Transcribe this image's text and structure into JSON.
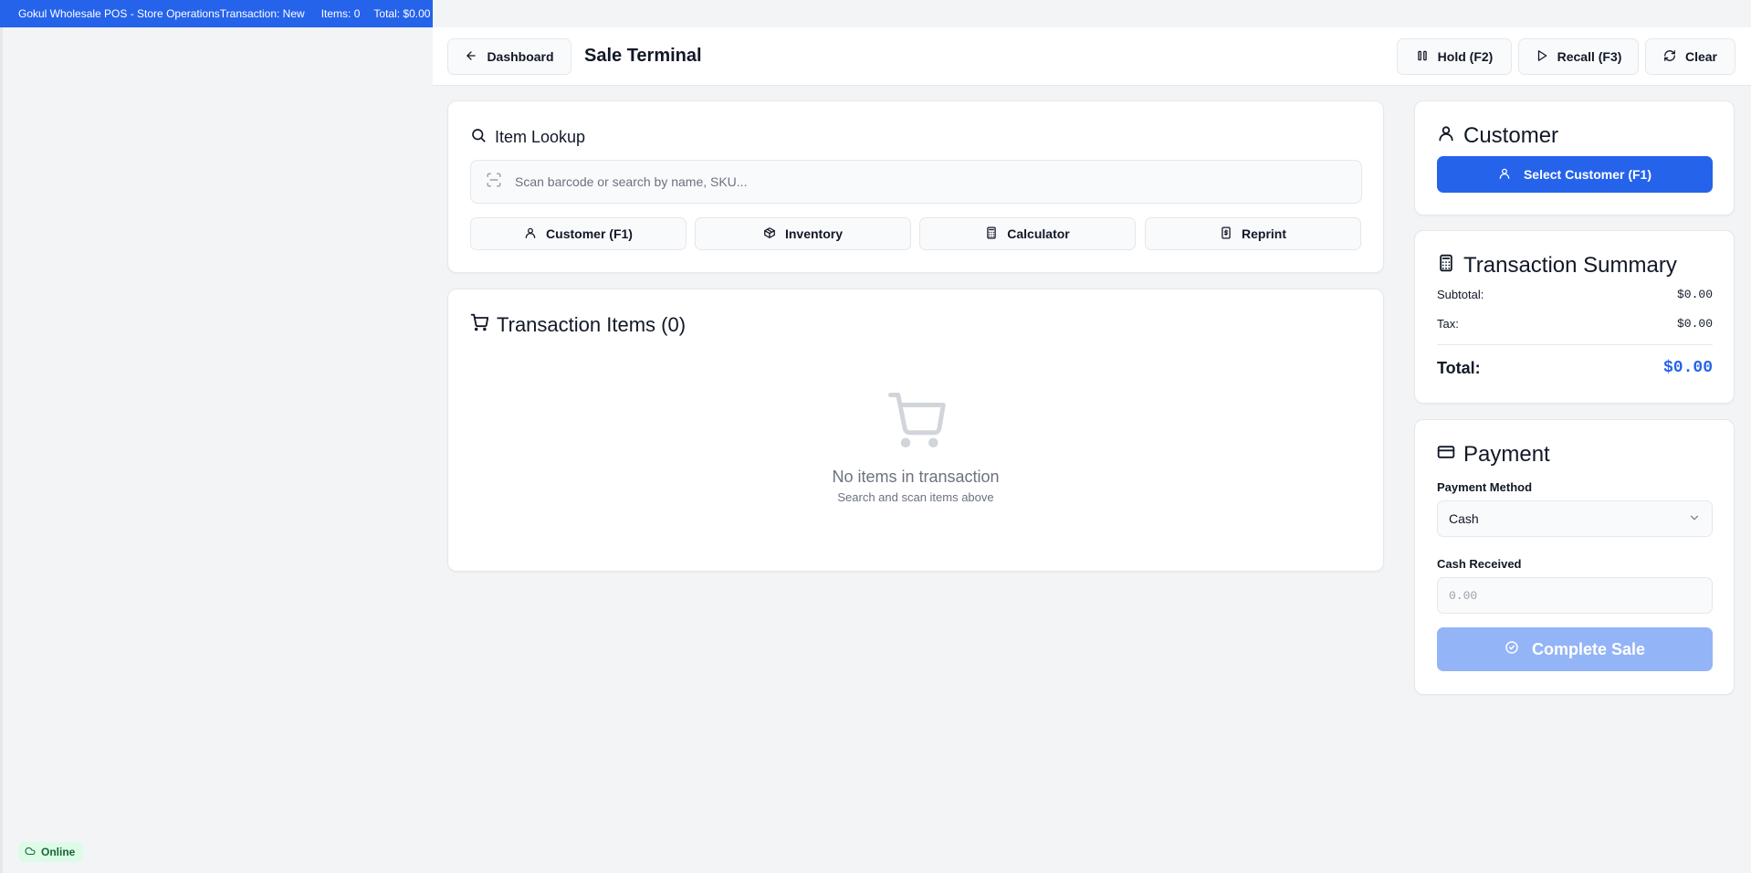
{
  "topbar": {
    "title": "Gokul Wholesale POS - Store Operations",
    "transaction": "Transaction: New",
    "items": "Items: 0",
    "total": "Total: $0.00",
    "color": "#2563eb"
  },
  "status": {
    "label": "Online"
  },
  "header": {
    "back_label": "Dashboard",
    "title": "Sale Terminal",
    "hold_label": "Hold (F2)",
    "recall_label": "Recall (F3)",
    "clear_label": "Clear"
  },
  "lookup": {
    "title": "Item Lookup",
    "placeholder": "Scan barcode or search by name, SKU...",
    "actions": [
      {
        "label": "Customer (F1)",
        "icon": "user-icon"
      },
      {
        "label": "Inventory",
        "icon": "package-icon"
      },
      {
        "label": "Calculator",
        "icon": "calculator-icon"
      },
      {
        "label": "Reprint",
        "icon": "receipt-icon"
      }
    ]
  },
  "transaction_items": {
    "title": "Transaction Items (0)",
    "empty_title": "No items in transaction",
    "empty_sub": "Search and scan items above"
  },
  "customer": {
    "title": "Customer",
    "select_label": "Select Customer (F1)"
  },
  "summary": {
    "title": "Transaction Summary",
    "subtotal_label": "Subtotal:",
    "subtotal_value": "$0.00",
    "tax_label": "Tax:",
    "tax_value": "$0.00",
    "total_label": "Total:",
    "total_value": "$0.00"
  },
  "payment": {
    "title": "Payment",
    "method_label": "Payment Method",
    "method_value": "Cash",
    "cash_label": "Cash Received",
    "cash_placeholder": "0.00",
    "complete_label": "Complete Sale"
  },
  "colors": {
    "accent": "#2563eb",
    "accent_disabled": "#93b4f7",
    "online_bg": "#dcfce7",
    "online_text": "#166534"
  }
}
